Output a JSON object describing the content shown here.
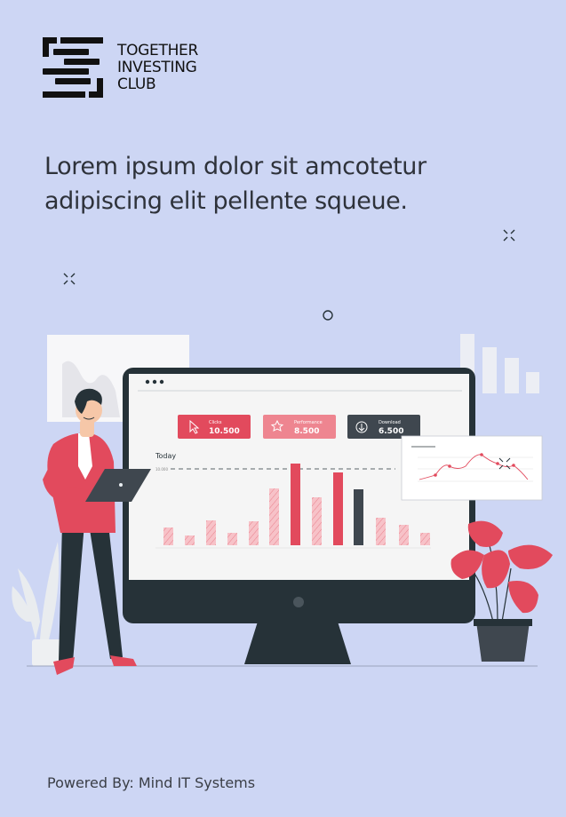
{
  "brand": {
    "name_lines": [
      "TOGETHER",
      "INVESTING",
      "CLUB"
    ]
  },
  "headline": {
    "line1": "Lorem ipsum dolor sit amcotetur",
    "line2": "adipiscing elit pellente squeue."
  },
  "footer": {
    "text": "Powered By: Mind IT Systems"
  },
  "dashboard": {
    "stats": [
      {
        "label": "Clicks",
        "value": "10.500",
        "icon": "cursor-icon",
        "color": "#e24a5d"
      },
      {
        "label": "Performance",
        "value": "8.500",
        "icon": "star-icon",
        "color": "#ee8590"
      },
      {
        "label": "Download",
        "value": "6.500",
        "icon": "download-icon",
        "color": "#3f474f"
      }
    ],
    "chart_title": "Today",
    "y_label": "10.000"
  },
  "colors": {
    "background": "#cdd6f4",
    "accent": "#e24a5d",
    "accent_light": "#f2a9b2",
    "dark": "#263238"
  }
}
